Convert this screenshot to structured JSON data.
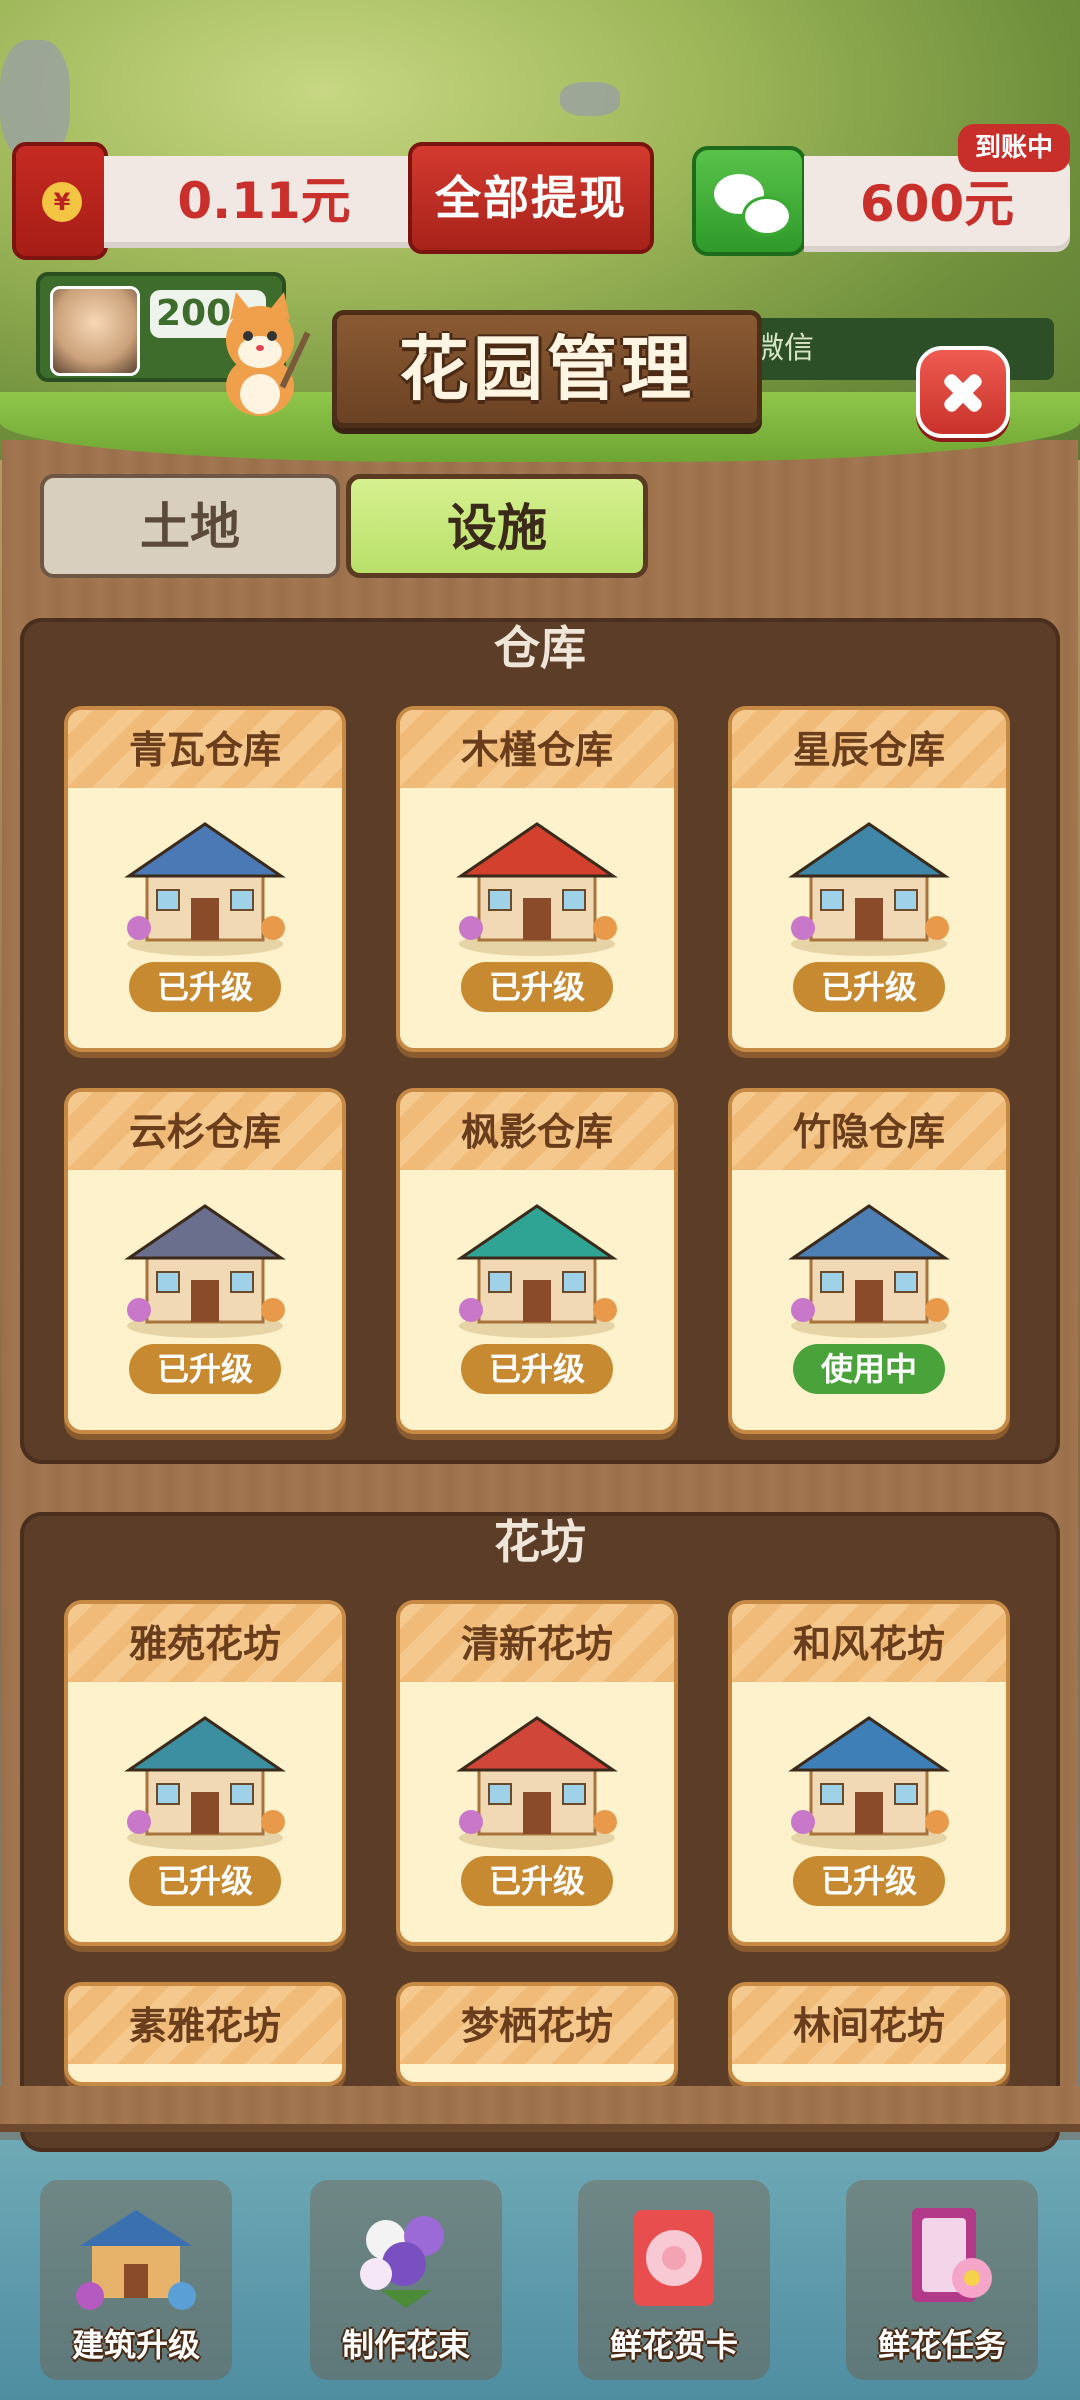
{
  "hud": {
    "balance": "0.11元",
    "withdraw_all": "全部提现",
    "wechat_amount": "600元",
    "arrival_badge": "到账中",
    "avatar_count": "200",
    "vine_text": "微信"
  },
  "modal": {
    "title": "花园管理",
    "tabs": [
      {
        "label": "土地",
        "active": false
      },
      {
        "label": "设施",
        "active": true
      }
    ]
  },
  "sections": [
    {
      "title": "仓库",
      "cards": [
        {
          "name": "青瓦仓库",
          "status": "已升级",
          "status_type": "upgraded",
          "roof": "#4b79b6"
        },
        {
          "name": "木槿仓库",
          "status": "已升级",
          "status_type": "upgraded",
          "roof": "#d4402e"
        },
        {
          "name": "星辰仓库",
          "status": "已升级",
          "status_type": "upgraded",
          "roof": "#3f86a8"
        },
        {
          "name": "云杉仓库",
          "status": "已升级",
          "status_type": "upgraded",
          "roof": "#6a6f8d"
        },
        {
          "name": "枫影仓库",
          "status": "已升级",
          "status_type": "upgraded",
          "roof": "#2fa494"
        },
        {
          "name": "竹隐仓库",
          "status": "使用中",
          "status_type": "inuse",
          "roof": "#4d7fb5"
        }
      ]
    },
    {
      "title": "花坊",
      "cards": [
        {
          "name": "雅苑花坊",
          "status": "已升级",
          "status_type": "upgraded",
          "roof": "#3b8fa0"
        },
        {
          "name": "清新花坊",
          "status": "已升级",
          "status_type": "upgraded",
          "roof": "#d0473a"
        },
        {
          "name": "和风花坊",
          "status": "已升级",
          "status_type": "upgraded",
          "roof": "#3f7fb8"
        },
        {
          "name": "素雅花坊",
          "status": "",
          "status_type": "hidden",
          "roof": "#5f76a3"
        },
        {
          "name": "梦栖花坊",
          "status": "",
          "status_type": "hidden",
          "roof": "#4f9ab0"
        },
        {
          "name": "林间花坊",
          "status": "",
          "status_type": "hidden",
          "roof": "#c9a045"
        }
      ]
    }
  ],
  "bottom_nav": [
    {
      "label": "建筑升级",
      "icon": "building-upgrade-icon"
    },
    {
      "label": "制作花束",
      "icon": "bouquet-icon"
    },
    {
      "label": "鲜花贺卡",
      "icon": "greeting-card-icon"
    },
    {
      "label": "鲜花任务",
      "icon": "flower-task-icon"
    }
  ]
}
